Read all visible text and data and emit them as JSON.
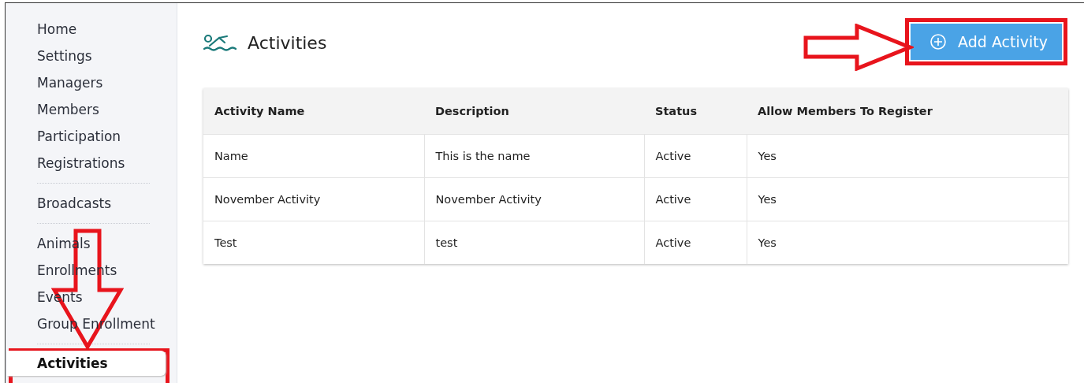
{
  "sidebar": {
    "groups": [
      {
        "items": [
          {
            "label": "Home",
            "selected": false
          },
          {
            "label": "Settings",
            "selected": false
          },
          {
            "label": "Managers",
            "selected": false
          },
          {
            "label": "Members",
            "selected": false
          },
          {
            "label": "Participation",
            "selected": false
          },
          {
            "label": "Registrations",
            "selected": false
          }
        ]
      },
      {
        "items": [
          {
            "label": "Broadcasts",
            "selected": false
          }
        ]
      },
      {
        "items": [
          {
            "label": "Animals",
            "selected": false
          },
          {
            "label": "Enrollments",
            "selected": false
          },
          {
            "label": "Events",
            "selected": false
          },
          {
            "label": "Group Enrollment",
            "selected": false
          }
        ]
      },
      {
        "items": [
          {
            "label": "Activities",
            "selected": true
          }
        ]
      }
    ]
  },
  "page": {
    "title": "Activities",
    "add_button": "Add Activity"
  },
  "table": {
    "columns": [
      "Activity Name",
      "Description",
      "Status",
      "Allow Members To Register"
    ],
    "rows": [
      [
        "Name",
        "This is the name",
        "Active",
        "Yes"
      ],
      [
        "November Activity",
        "November Activity",
        "Active",
        "Yes"
      ],
      [
        "Test",
        "test",
        "Active",
        "Yes"
      ]
    ]
  }
}
